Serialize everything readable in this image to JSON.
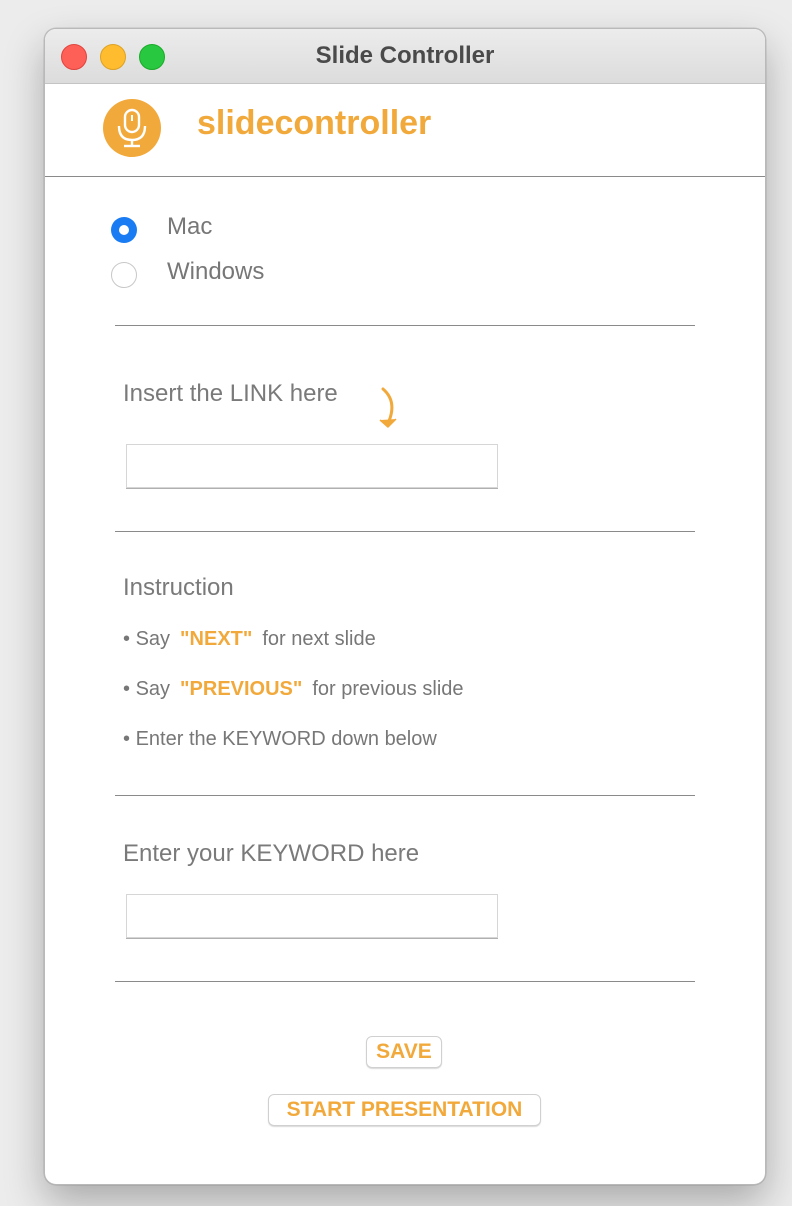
{
  "window": {
    "title": "Slide Controller"
  },
  "header": {
    "brand": "slidecontroller",
    "logo_icon": "microphone-icon",
    "accent": "#f2a93b"
  },
  "platform": {
    "options": [
      {
        "label": "Mac",
        "selected": true
      },
      {
        "label": "Windows",
        "selected": false
      }
    ]
  },
  "link": {
    "label": "Insert the LINK here",
    "value": "",
    "arrow_icon": "curved-arrow-down-icon"
  },
  "instruction": {
    "heading": "Instruction",
    "bullet": "•",
    "items": [
      {
        "prefix": "Say",
        "keyword": "\"NEXT\"",
        "suffix": "for next slide"
      },
      {
        "prefix": "Say",
        "keyword": "\"PREVIOUS\"",
        "suffix": "for previous slide"
      },
      {
        "prefix": "Enter the KEYWORD down below",
        "keyword": "",
        "suffix": ""
      }
    ]
  },
  "keyword": {
    "label": "Enter your KEYWORD here",
    "value": ""
  },
  "actions": {
    "save_label": "SAVE",
    "start_label": "START PRESENTATION"
  }
}
